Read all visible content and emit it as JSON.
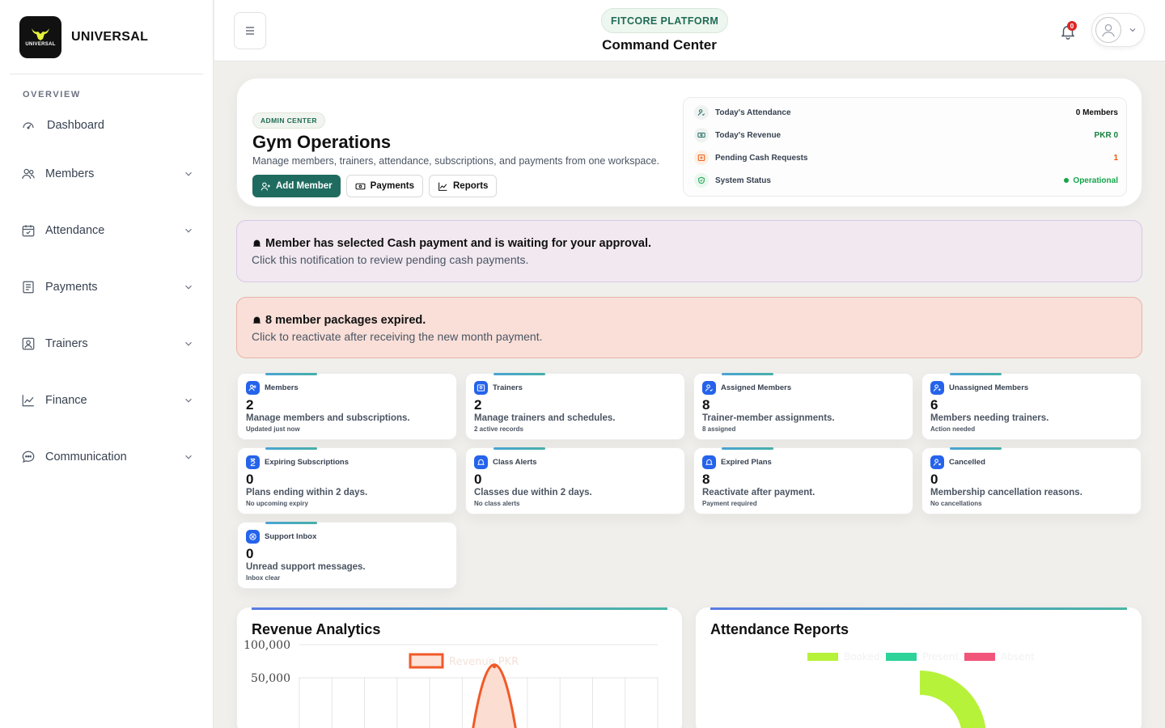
{
  "brand": {
    "name": "UNIVERSAL",
    "logo_text": "UNIVERSAL"
  },
  "sidebar": {
    "section": "OVERVIEW",
    "items": [
      {
        "label": "Dashboard",
        "icon": "gauge-icon",
        "has_submenu": false
      },
      {
        "label": "Members",
        "icon": "users-icon",
        "has_submenu": true
      },
      {
        "label": "Attendance",
        "icon": "calendar-check-icon",
        "has_submenu": true
      },
      {
        "label": "Payments",
        "icon": "receipt-icon",
        "has_submenu": true
      },
      {
        "label": "Trainers",
        "icon": "id-card-icon",
        "has_submenu": true
      },
      {
        "label": "Finance",
        "icon": "line-chart-icon",
        "has_submenu": true
      },
      {
        "label": "Communication",
        "icon": "chat-bubble-icon",
        "has_submenu": true
      }
    ]
  },
  "header": {
    "platform": "FITCORE PLATFORM",
    "title": "Command Center",
    "notification_count": "0"
  },
  "hero": {
    "badge": "ADMIN CENTER",
    "title": "Gym Operations",
    "subtitle": "Manage members, trainers, attendance, subscriptions, and payments from one workspace.",
    "actions": {
      "add_member": "Add Member",
      "payments": "Payments",
      "reports": "Reports"
    },
    "stats": [
      {
        "label": "Today's Attendance",
        "value": "0 Members",
        "color": "#111111"
      },
      {
        "label": "Today's Revenue",
        "value": "PKR 0",
        "color": "#15803d"
      },
      {
        "label": "Pending Cash Requests",
        "value": "1",
        "color": "#ea580c"
      },
      {
        "label": "System Status",
        "value": "Operational",
        "color": "#16a34a"
      }
    ]
  },
  "notifications": [
    {
      "title": "Member has selected Cash payment and is waiting for your approval.",
      "text": "Click this notification to review pending cash payments."
    },
    {
      "title": "8 member packages expired.",
      "text": "Click to reactivate after receiving the new month payment."
    }
  ],
  "cards": [
    {
      "title": "Members",
      "value": "2",
      "desc": "Manage members and subscriptions.",
      "meta": "Updated just now",
      "icon": "users-icon"
    },
    {
      "title": "Trainers",
      "value": "2",
      "desc": "Manage trainers and schedules.",
      "meta": "2 active records",
      "icon": "id-card-icon"
    },
    {
      "title": "Assigned Members",
      "value": "8",
      "desc": "Trainer-member assignments.",
      "meta": "8 assigned",
      "icon": "user-check-icon"
    },
    {
      "title": "Unassigned Members",
      "value": "6",
      "desc": "Members needing trainers.",
      "meta": "Action needed",
      "icon": "user-plus-icon"
    },
    {
      "title": "Expiring Subscriptions",
      "value": "0",
      "desc": "Plans ending within 2 days.",
      "meta": "No upcoming expiry",
      "icon": "hourglass-icon"
    },
    {
      "title": "Class Alerts",
      "value": "0",
      "desc": "Classes due within 2 days.",
      "meta": "No class alerts",
      "icon": "bell-icon"
    },
    {
      "title": "Expired Plans",
      "value": "8",
      "desc": "Reactivate after payment.",
      "meta": "Payment required",
      "icon": "bell-icon"
    },
    {
      "title": "Cancelled",
      "value": "0",
      "desc": "Membership cancellation reasons.",
      "meta": "No cancellations",
      "icon": "user-x-icon"
    },
    {
      "title": "Support Inbox",
      "value": "0",
      "desc": "Unread support messages.",
      "meta": "Inbox clear",
      "icon": "support-icon"
    }
  ],
  "analytics": {
    "revenue_title": "Revenue Analytics",
    "attendance_title": "Attendance Reports"
  },
  "chart_data": [
    {
      "type": "area",
      "title": "Revenue Analytics",
      "series": [
        {
          "name": "Revenue PKR",
          "color": "#f05a28"
        }
      ],
      "y_ticks": [
        "100,000",
        "50,000"
      ],
      "ylim": [
        0,
        110000
      ],
      "visible_peak": 70000,
      "grid": true,
      "legend": "top-center"
    },
    {
      "type": "pie",
      "title": "Attendance Reports",
      "series": [
        {
          "name": "Booked",
          "color": "#b7f23a"
        },
        {
          "name": "Present",
          "color": "#2ed39a"
        },
        {
          "name": "Absent",
          "color": "#f2557a"
        }
      ],
      "legend": "top-center"
    }
  ]
}
